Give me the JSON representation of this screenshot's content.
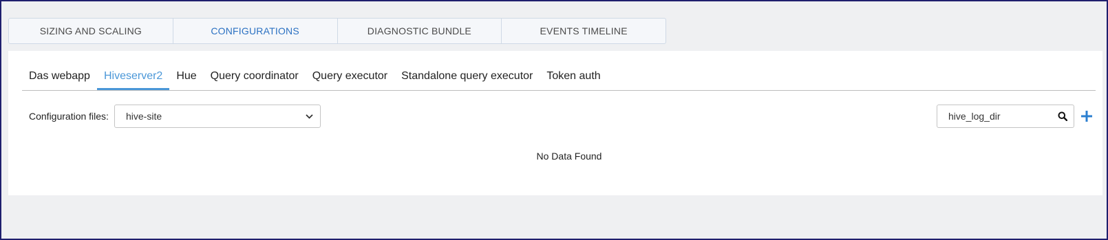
{
  "top_tabs": [
    {
      "label": "SIZING AND SCALING",
      "active": false
    },
    {
      "label": "CONFIGURATIONS",
      "active": true
    },
    {
      "label": "DIAGNOSTIC BUNDLE",
      "active": false
    },
    {
      "label": "EVENTS TIMELINE",
      "active": false
    }
  ],
  "sub_tabs": [
    {
      "label": "Das webapp",
      "active": false
    },
    {
      "label": "Hiveserver2",
      "active": true
    },
    {
      "label": "Hue",
      "active": false
    },
    {
      "label": "Query coordinator",
      "active": false
    },
    {
      "label": "Query executor",
      "active": false
    },
    {
      "label": "Standalone query executor",
      "active": false
    },
    {
      "label": "Token auth",
      "active": false
    }
  ],
  "config": {
    "label": "Configuration files:",
    "selected": "hive-site"
  },
  "search": {
    "value": "hive_log_dir"
  },
  "empty_message": "No Data Found",
  "colors": {
    "accent": "#2b71c2",
    "sub_tab_active": "#4a97d8",
    "add_button": "#2b7fd0",
    "border": "#1f1f6e"
  },
  "icons": {
    "search": "search-icon",
    "add": "plus-icon",
    "dropdown": "chevron-down-icon"
  }
}
